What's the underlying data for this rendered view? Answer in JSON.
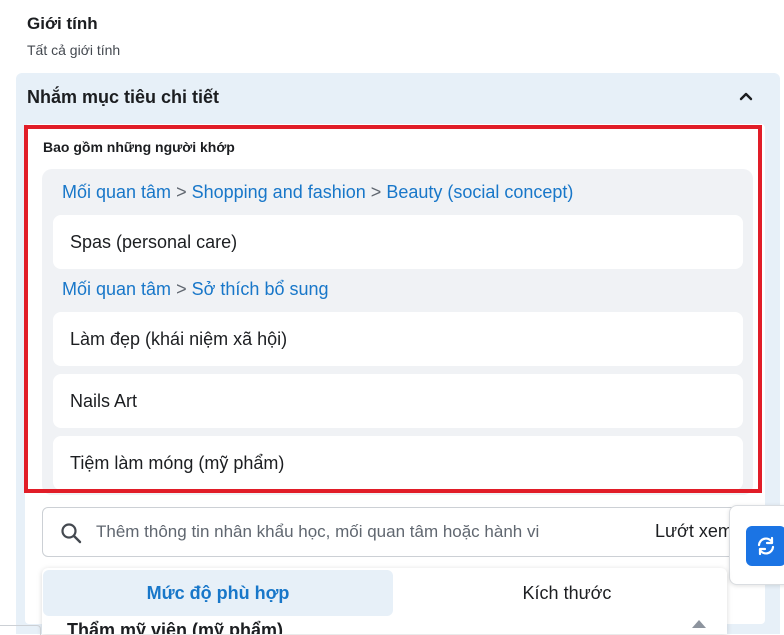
{
  "gender": {
    "title": "Giới tính",
    "value": "Tất cả giới tính"
  },
  "detailed_targeting": {
    "title": "Nhắm mục tiêu chi tiết",
    "include_label": "Bao gồm những người khớp",
    "groups": [
      {
        "path": [
          "Mối quan tâm",
          "Shopping and fashion",
          "Beauty (social concept)"
        ],
        "items": [
          "Spas (personal care)"
        ]
      },
      {
        "path": [
          "Mối quan tâm",
          "Sở thích bổ sung"
        ],
        "items": [
          "Làm đẹp (khái niệm xã hội)",
          "Nails Art",
          "Tiệm làm móng (mỹ phẩm)"
        ]
      }
    ],
    "separator": ">",
    "search": {
      "placeholder": "Thêm thông tin nhân khẩu học, mối quan tâm hoặc hành vi",
      "browse_label": "Lướt xem"
    }
  },
  "dropdown": {
    "tabs": [
      "Mức độ phù hợp",
      "Kích thước"
    ],
    "active_tab": "Mức độ phù hợp",
    "first_suggestion": "Thẩm mỹ viện (mỹ phẩm)"
  },
  "icons": {
    "collapse": "chevron-up-icon",
    "search": "search-icon",
    "refresh": "refresh-icon"
  },
  "colors": {
    "accent": "#1877c9",
    "panel": "#e7f0f8",
    "highlight": "#e11d28",
    "button": "#1b74e4"
  }
}
